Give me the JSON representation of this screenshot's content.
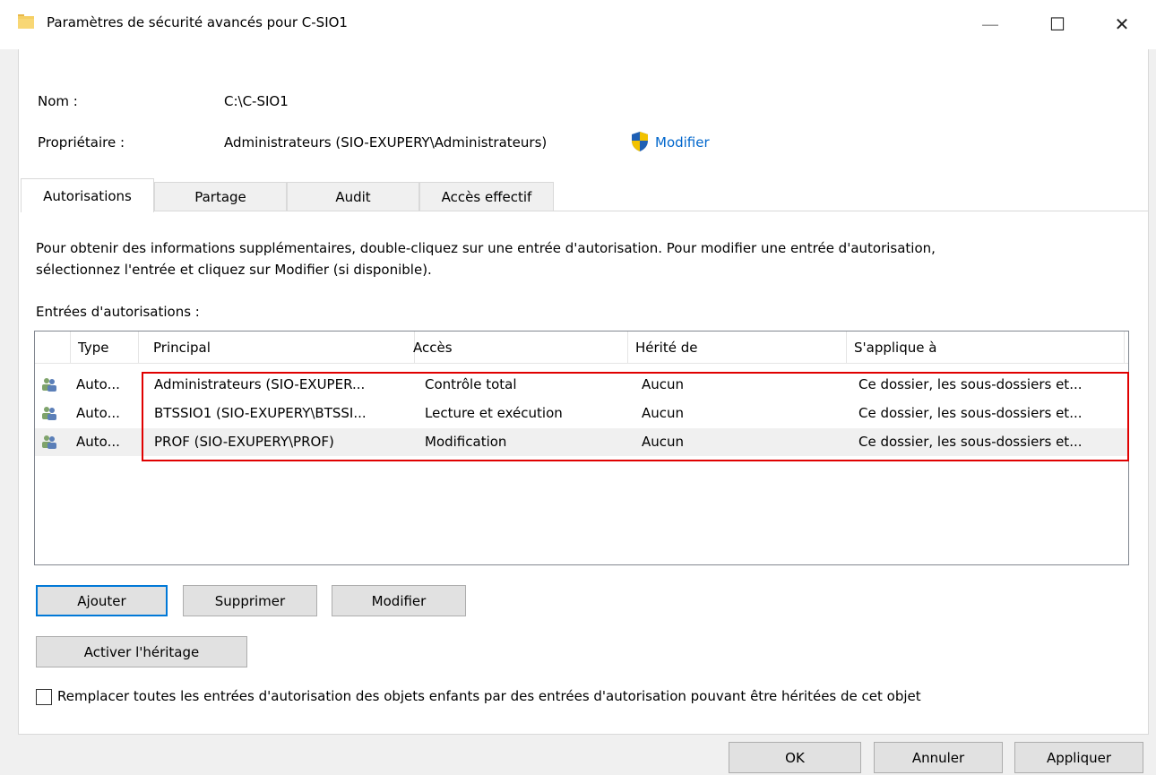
{
  "window": {
    "title": "Paramètres de sécurité avancés pour C-SIO1",
    "minimize": "—",
    "maximize": "☐",
    "close": "✕"
  },
  "info": {
    "name_label": "Nom :",
    "name_value": "C:\\C-SIO1",
    "owner_label": "Propriétaire :",
    "owner_value": "Administrateurs (SIO-EXUPERY\\Administrateurs)",
    "owner_change_link": "Modifier"
  },
  "tabs": [
    {
      "label": "Autorisations",
      "active": true
    },
    {
      "label": "Partage",
      "active": false
    },
    {
      "label": "Audit",
      "active": false
    },
    {
      "label": "Accès effectif",
      "active": false
    }
  ],
  "instructions": {
    "line1": "Pour obtenir des informations supplémentaires, double-cliquez sur une entrée d'autorisation. Pour modifier une entrée d'autorisation,",
    "line2": "sélectionnez l'entrée et cliquez sur Modifier (si disponible)."
  },
  "entries_label": "Entrées d'autorisations :",
  "table": {
    "columns": [
      "Type",
      "Principal",
      "Accès",
      "Hérité de",
      "S'applique à"
    ],
    "rows": [
      {
        "type": "Auto...",
        "principal": "Administrateurs (SIO-EXUPER...",
        "access": "Contrôle total",
        "inherited": "Aucun",
        "applies": "Ce dossier, les sous-dossiers et..."
      },
      {
        "type": "Auto...",
        "principal": "BTSSIO1 (SIO-EXUPERY\\BTSSI...",
        "access": "Lecture et exécution",
        "inherited": "Aucun",
        "applies": "Ce dossier, les sous-dossiers et..."
      },
      {
        "type": "Auto...",
        "principal": "PROF (SIO-EXUPERY\\PROF)",
        "access": "Modification",
        "inherited": "Aucun",
        "applies": "Ce dossier, les sous-dossiers et..."
      }
    ]
  },
  "buttons": {
    "add": "Ajouter",
    "remove": "Supprimer",
    "edit": "Modifier",
    "enable_inheritance": "Activer l'héritage",
    "ok": "OK",
    "cancel": "Annuler",
    "apply": "Appliquer"
  },
  "replace_checkbox": {
    "label": "Remplacer toutes les entrées d'autorisation des objets enfants par des entrées d'autorisation pouvant être héritées de cet objet",
    "checked": false
  },
  "colors": {
    "accent": "#0078d7",
    "link": "#0066cc",
    "highlight": "#e00000"
  }
}
